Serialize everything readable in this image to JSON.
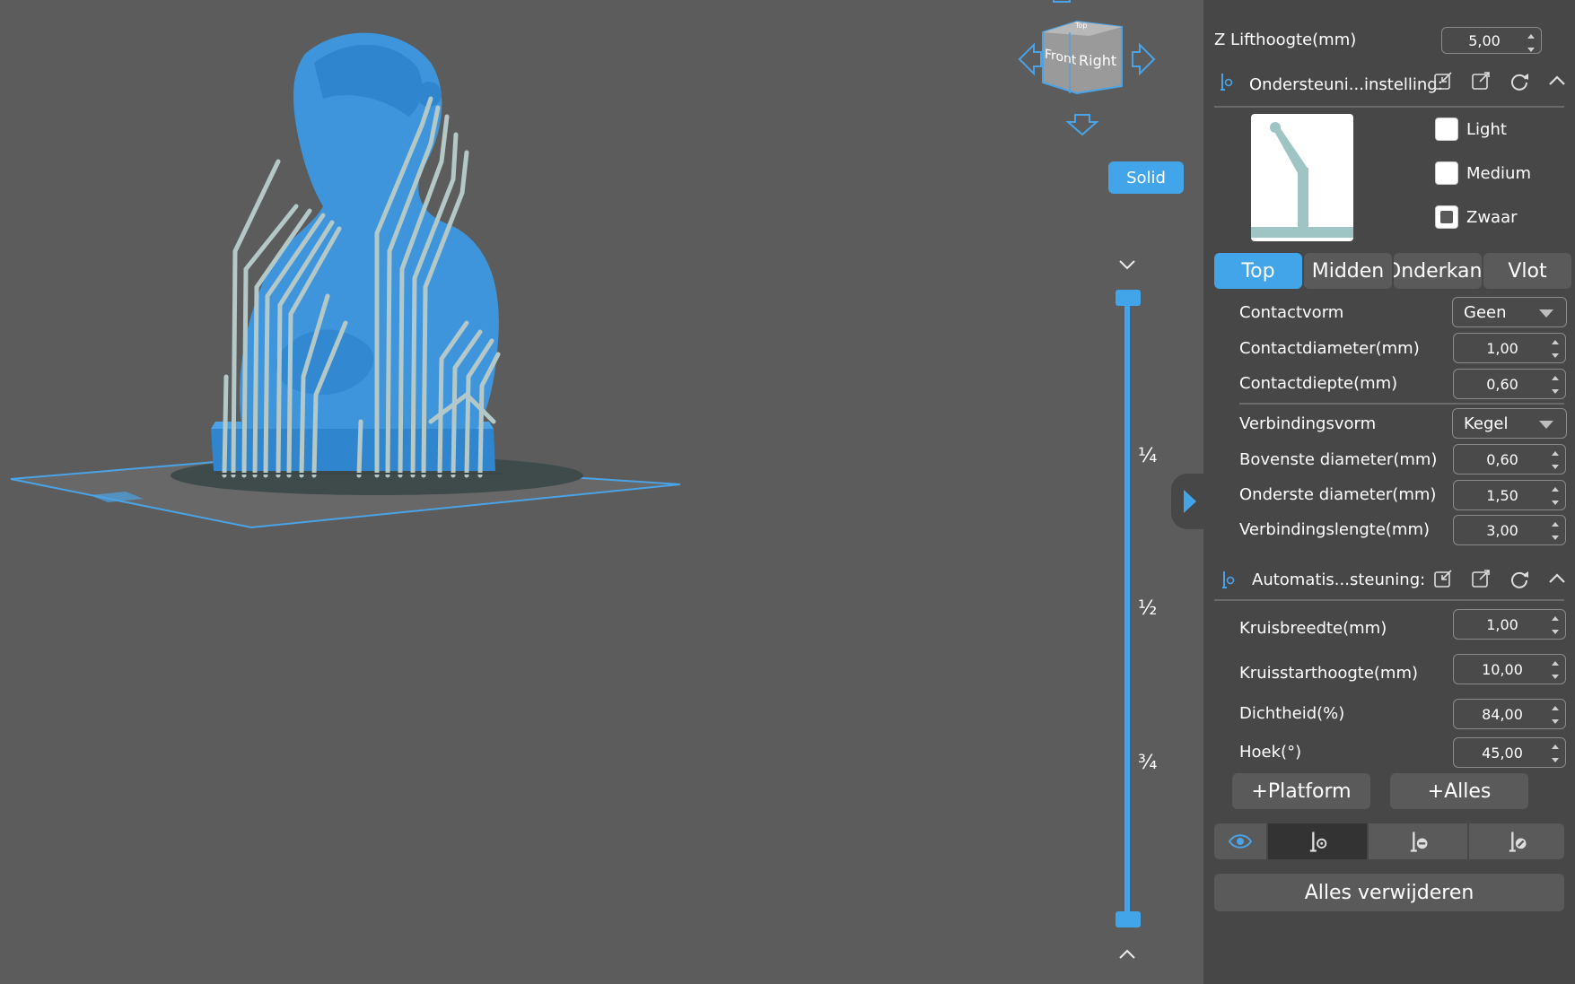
{
  "viewport": {
    "view_cube": {
      "front_label": "Front",
      "right_label": "Right",
      "top_label": "Top"
    },
    "render_mode_button": "Solid",
    "slider_marks": [
      "¼",
      "½",
      "¾"
    ]
  },
  "panel": {
    "z_lift": {
      "label": "Z Lifthoogte(mm)",
      "value": "5,00"
    },
    "support_settings": {
      "title": "Ondersteuni...instelling:",
      "presets": [
        {
          "label": "Light",
          "checked": false
        },
        {
          "label": "Medium",
          "checked": false
        },
        {
          "label": "Zwaar",
          "checked": true
        }
      ],
      "tabs": [
        "Top",
        "Midden",
        "Onderkant",
        "Vlot"
      ],
      "active_tab": "Top",
      "fields": {
        "contact_shape": {
          "label": "Contactvorm",
          "value": "Geen"
        },
        "contact_diameter": {
          "label": "Contactdiameter(mm)",
          "value": "1,00"
        },
        "contact_depth": {
          "label": "Contactdiepte(mm)",
          "value": "0,60"
        },
        "connection_shape": {
          "label": "Verbindingsvorm",
          "value": "Kegel"
        },
        "upper_diameter": {
          "label": "Bovenste diameter(mm)",
          "value": "0,60"
        },
        "lower_diameter": {
          "label": "Onderste diameter(mm)",
          "value": "1,50"
        },
        "connection_length": {
          "label": "Verbindingslengte(mm)",
          "value": "3,00"
        }
      }
    },
    "auto_support": {
      "title": "Automatis...steuning:",
      "fields": {
        "cross_width": {
          "label": "Kruisbreedte(mm)",
          "value": "1,00"
        },
        "cross_start_height": {
          "label": "Kruisstarthoogte(mm)",
          "value": "10,00"
        },
        "density": {
          "label": "Dichtheid(%)",
          "value": "84,00"
        },
        "angle": {
          "label": "Hoek(°)",
          "value": "45,00"
        }
      },
      "platform_button": "+Platform",
      "all_button": "+Alles"
    },
    "remove_all_button": "Alles verwijderen"
  },
  "colors": {
    "accent": "#42a5ea",
    "model": "#3e95dc",
    "supports": "#b4c8c8",
    "panel_bg": "#474747",
    "viewport_bg": "#5c5c5c"
  }
}
